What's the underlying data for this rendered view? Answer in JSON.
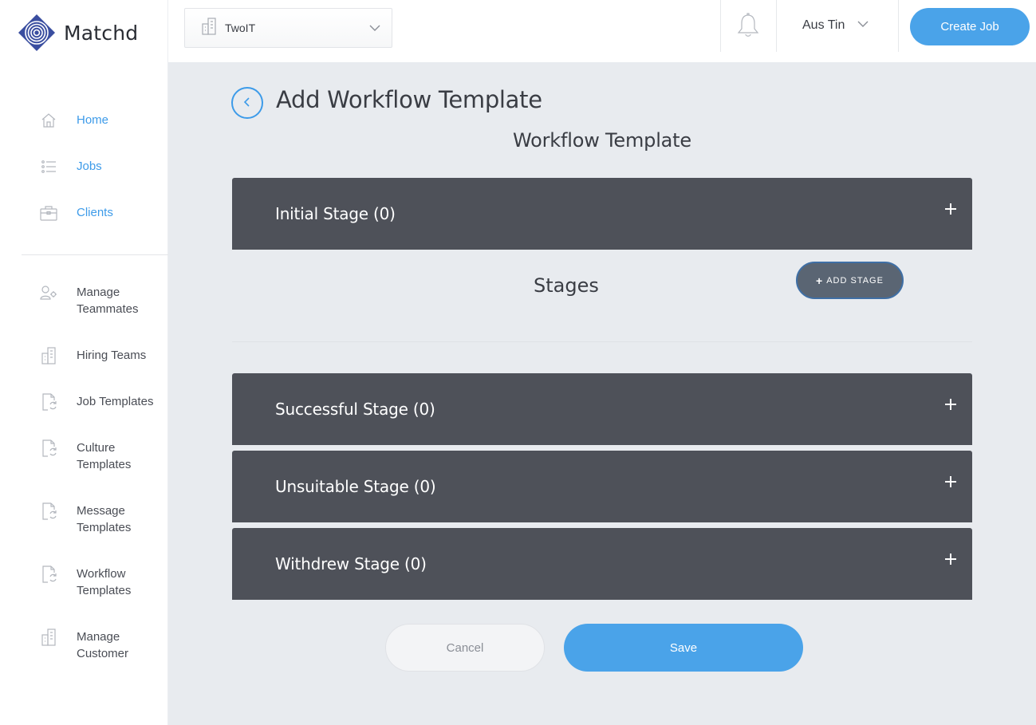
{
  "brand": {
    "name": "Matchd",
    "accent": "#3d9be9"
  },
  "topbar": {
    "company": "TwoIT",
    "user_name": "Aus Tin",
    "create_job_label": "Create Job"
  },
  "sidebar": {
    "primary_items": [
      {
        "label": "Home",
        "icon": "home-icon"
      },
      {
        "label": "Jobs",
        "icon": "list-icon"
      },
      {
        "label": "Clients",
        "icon": "briefcase-icon"
      }
    ],
    "secondary_items": [
      {
        "label": "Manage Teammates",
        "icon": "user-gear-icon"
      },
      {
        "label": "Hiring Teams",
        "icon": "building-icon"
      },
      {
        "label": "Job Templates",
        "icon": "file-refresh-icon"
      },
      {
        "label": "Culture Templates",
        "icon": "file-refresh-icon"
      },
      {
        "label": "Message Templates",
        "icon": "file-refresh-icon"
      },
      {
        "label": "Workflow Templates",
        "icon": "file-refresh-icon"
      },
      {
        "label": "Manage Customer",
        "icon": "building-icon"
      }
    ]
  },
  "main": {
    "page_title": "Add Workflow Template",
    "section_title": "Workflow Template",
    "stages": [
      {
        "label": "Initial Stage (0)"
      },
      {
        "label": "Successful Stage (0)"
      },
      {
        "label": "Unsuitable Stage (0)"
      },
      {
        "label": "Withdrew Stage (0)"
      }
    ],
    "stages_panel": {
      "title": "Stages",
      "add_label": "ADD STAGE"
    },
    "cancel_label": "Cancel",
    "save_label": "Save"
  }
}
